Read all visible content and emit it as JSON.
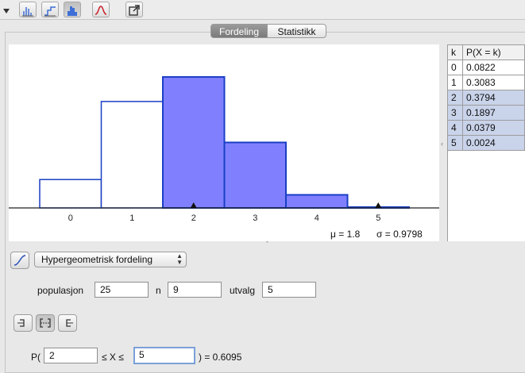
{
  "tabs": {
    "distribution": "Fordeling",
    "statistics": "Statistikk"
  },
  "toolbar": {
    "icons": [
      "bar-graph-icon",
      "step-graph-icon",
      "histogram-icon",
      "density-curve-icon",
      "export-icon"
    ],
    "active": "histogram-icon"
  },
  "chart_data": {
    "type": "bar",
    "categories": [
      "0",
      "1",
      "2",
      "3",
      "4",
      "5"
    ],
    "values": [
      0.0822,
      0.3083,
      0.3794,
      0.1897,
      0.0379,
      0.0024
    ],
    "highlighted": [
      "2",
      "3",
      "4",
      "5"
    ],
    "colors": {
      "highlight": "#8080ff",
      "outline": "#1a3fc4"
    },
    "ylim": [
      0,
      0.4
    ],
    "mean_marker": 1.8,
    "stats": {
      "mu": "μ = 1.8",
      "sigma": "σ = 0.9798"
    }
  },
  "table": {
    "headers": [
      "k",
      "P(X = k)"
    ],
    "rows": [
      {
        "k": "0",
        "p": "0.0822"
      },
      {
        "k": "1",
        "p": "0.3083"
      },
      {
        "k": "2",
        "p": "0.3794"
      },
      {
        "k": "3",
        "p": "0.1897"
      },
      {
        "k": "4",
        "p": "0.0379"
      },
      {
        "k": "5",
        "p": "0.0024"
      }
    ]
  },
  "distribution": {
    "selected": "Hypergeometrisk fordeling"
  },
  "params": {
    "population_label": "populasjon",
    "population_value": "25",
    "n_label": "n",
    "n_value": "9",
    "sample_label": "utvalg",
    "sample_value": "5"
  },
  "probability": {
    "prefix": "P(",
    "lower": "2",
    "middle": "≤ X ≤",
    "upper": "5",
    "result": ") =  0.6095"
  }
}
